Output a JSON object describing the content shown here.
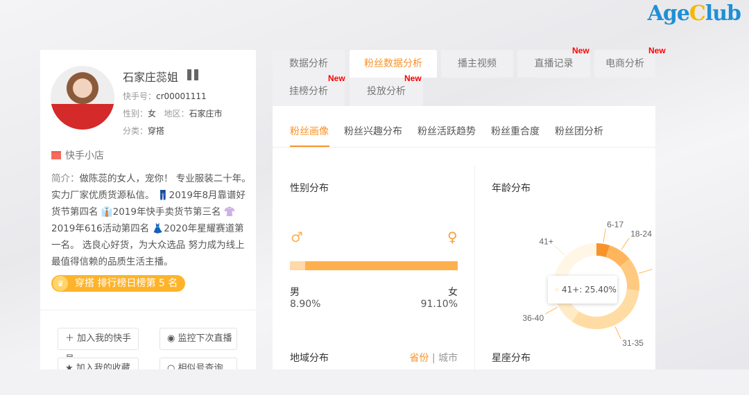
{
  "logo": {
    "part1": "Age",
    "part2": "C",
    "part3": "lub"
  },
  "profile": {
    "name": "石家庄蕊姐",
    "id_label": "快手号：",
    "id": "cr00001111",
    "gender_label": "性别：",
    "gender": "女",
    "region_label": "地区：",
    "region": "石家庄市",
    "category_label": "分类：",
    "category": "穿搭",
    "shop": "快手小店",
    "bio_label": "简介：",
    "bio": "做陈蕊的女人，宠你！ 专业服装二十年。 实力厂家优质货源私信。 👖2019年8月靠谱好货节第四名 👔2019年快手卖货节第三名 👚2019年616活动第四名 👗2020年星耀赛道第一名。 选良心好货，为大众选品 努力成为线上最值得信赖的品质生活主播。",
    "rank_badge": "穿搭 排行榜日榜第 5 名"
  },
  "actions": [
    {
      "label": "加入我的快手号",
      "icon": "plus-icon"
    },
    {
      "label": "监控下次直播",
      "icon": "eye-icon"
    },
    {
      "label": "加入我的收藏",
      "icon": "star-icon"
    },
    {
      "label": "相似号查询",
      "icon": "search-icon"
    }
  ],
  "tabs": [
    {
      "label": "数据分析"
    },
    {
      "label": "粉丝数据分析",
      "active": true
    },
    {
      "label": "播主视频"
    },
    {
      "label": "直播记录",
      "badge": "New"
    },
    {
      "label": "电商分析",
      "badge": "New"
    },
    {
      "label": "挂榜分析",
      "badge": "New"
    },
    {
      "label": "投放分析",
      "badge": "New"
    }
  ],
  "subtabs": [
    "粉丝画像",
    "粉丝兴趣分布",
    "粉丝活跃趋势",
    "粉丝重合度",
    "粉丝团分析"
  ],
  "gender": {
    "title": "性别分布",
    "male_label": "男",
    "male": "8.90%",
    "female_label": "女",
    "female": "91.10%"
  },
  "region": {
    "title": "地域分布",
    "opt1": "省份",
    "sep": "|",
    "opt2": "城市"
  },
  "constellation": {
    "title": "星座分布"
  },
  "colors": {
    "accent": "#f7932a",
    "badge": "#fdb42b",
    "new": "#ff0000"
  },
  "chart_data": {
    "type": "pie",
    "title": "年龄分布",
    "donut": true,
    "categories": [
      "6-17",
      "18-24",
      "",
      "31-35",
      "36-40",
      "41+"
    ],
    "values": [
      5,
      9,
      12.6,
      33,
      15,
      25.4
    ],
    "colors": [
      "#f7932a",
      "#ffb55c",
      "#ffc980",
      "#ffdca3",
      "#ffebc6",
      "#fff6e6"
    ],
    "tooltip": "41+: 25.40%"
  }
}
